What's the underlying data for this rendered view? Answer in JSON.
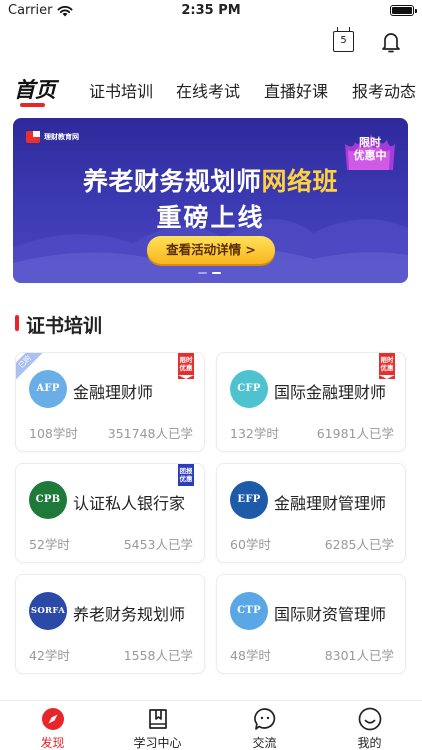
{
  "status_bar": {
    "carrier": "Carrier",
    "time": "2:35 PM"
  },
  "header": {
    "calendar_day": "5"
  },
  "top_tabs": [
    {
      "label": "首页",
      "active": true
    },
    {
      "label": "证书培训"
    },
    {
      "label": "在线考试"
    },
    {
      "label": "直播好课"
    },
    {
      "label": "报考动态"
    }
  ],
  "banner": {
    "logo_text": "理财教育网",
    "badge": [
      "限时",
      "优惠中"
    ],
    "title_prefix": "养老财务规划师",
    "title_highlight": "网络班",
    "subtitle": "重磅上线",
    "button": "查看活动详情 >",
    "page_count": 2,
    "active_page": 1
  },
  "section": {
    "title": "证书培训"
  },
  "courses": [
    {
      "code": "AFP",
      "name": "金融理财师",
      "hours": "108学时",
      "learners": "351748人已学",
      "logo_color": "#6aaee8",
      "badge": [
        "限时",
        "优惠"
      ],
      "badge_color": "red",
      "corner": "已购"
    },
    {
      "code": "CFP",
      "name": "国际金融理财师",
      "hours": "132学时",
      "learners": "61981人已学",
      "logo_color": "#4ec3cf",
      "badge": [
        "限时",
        "优惠"
      ],
      "badge_color": "red"
    },
    {
      "code": "CPB",
      "name": "认证私人银行家",
      "hours": "52学时",
      "learners": "5453人已学",
      "logo_color": "#1f7a3a",
      "badge": [
        "团报",
        "优惠"
      ],
      "badge_color": "blue"
    },
    {
      "code": "EFP",
      "name": "金融理财管理师",
      "hours": "60学时",
      "learners": "6285人已学",
      "logo_color": "#1d5aa8"
    },
    {
      "code": "SORFA",
      "name": "养老财务规划师",
      "hours": "42学时",
      "learners": "1558人已学",
      "logo_color": "#2b4aa8"
    },
    {
      "code": "CTP",
      "name": "国际财资管理师",
      "hours": "48学时",
      "learners": "8301人已学",
      "logo_color": "#5aa7e6"
    }
  ],
  "tab_bar": [
    {
      "label": "发现",
      "icon": "compass-icon",
      "active": true
    },
    {
      "label": "学习中心",
      "icon": "book-icon"
    },
    {
      "label": "交流",
      "icon": "chat-icon"
    },
    {
      "label": "我的",
      "icon": "smile-icon"
    }
  ],
  "colors": {
    "accent": "#e8262a",
    "banner": "#3a37ad",
    "cta": "#f9c42a"
  }
}
